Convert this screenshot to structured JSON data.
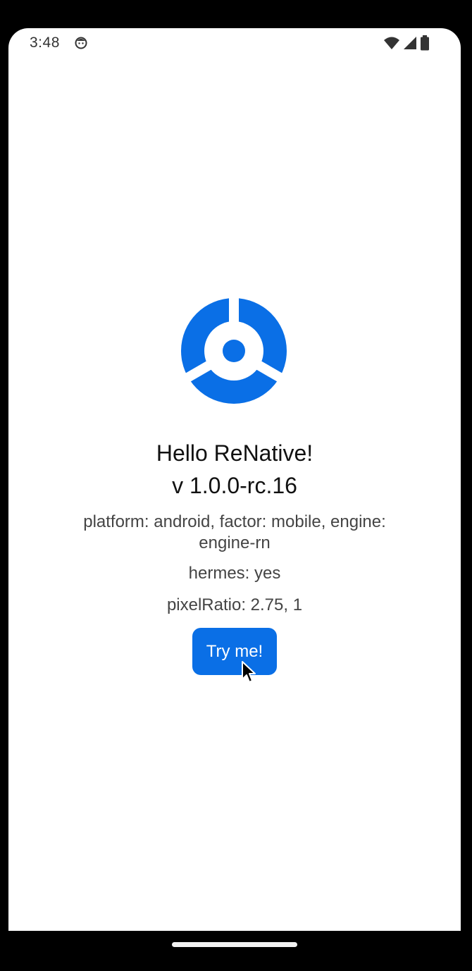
{
  "status_bar": {
    "time": "3:48",
    "notification_icon": "android-notification-icon",
    "wifi_icon": "wifi-icon",
    "signal_icon": "cellular-signal-icon",
    "battery_icon": "battery-icon"
  },
  "main": {
    "logo_icon": "renative-logo-icon",
    "title": "Hello ReNative!",
    "version": "v 1.0.0-rc.16",
    "platform_info": "platform: android, factor: mobile, engine: engine-rn",
    "hermes_info": "hermes: yes",
    "pixel_ratio_info": "pixelRatio: 2.75, 1",
    "try_button_label": "Try me!"
  },
  "nav_bar": {
    "home_indicator": "home-gesture-pill"
  },
  "colors": {
    "accent": "#0a6fe6",
    "background": "#ffffff",
    "frame": "#000000"
  }
}
